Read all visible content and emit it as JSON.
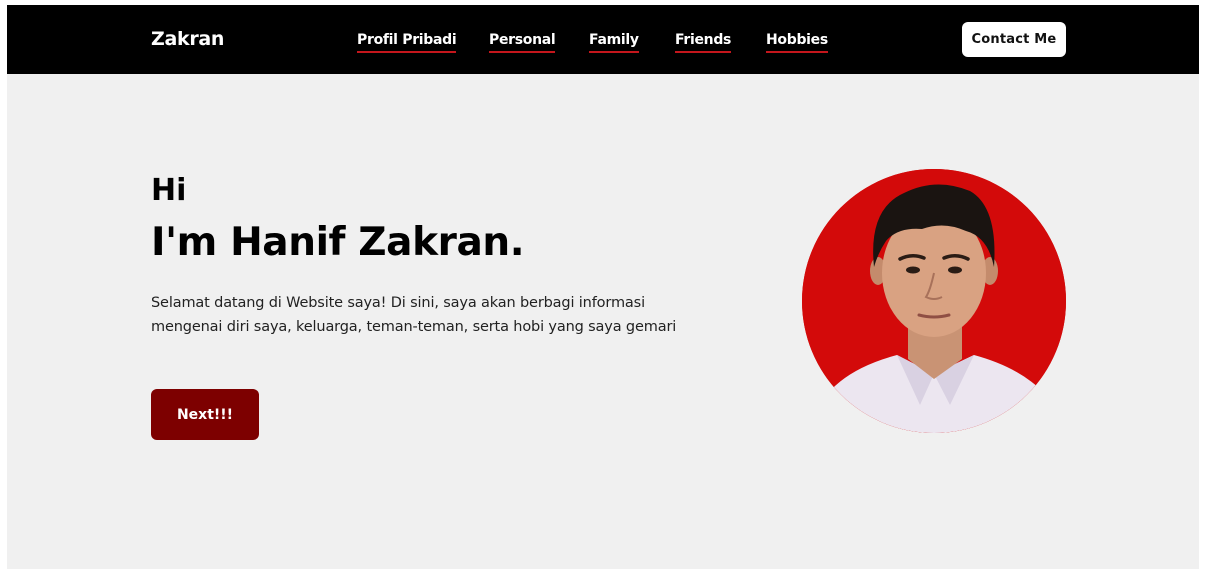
{
  "navbar": {
    "brand": "Zakran",
    "links": [
      {
        "label": "Profil Pribadi"
      },
      {
        "label": "Personal"
      },
      {
        "label": "Family"
      },
      {
        "label": "Friends"
      },
      {
        "label": "Hobbies"
      }
    ],
    "contact_label": "Contact Me"
  },
  "hero": {
    "greeting": "Hi",
    "name": "I'm Hanif Zakran.",
    "description": "Selamat datang di Website saya! Di sini, saya akan berbagi informasi mengenai diri saya, keluarga, teman-teman, serta hobi yang saya gemari",
    "next_label": "Next!!!"
  },
  "colors": {
    "navbar_bg": "#000000",
    "link_underline": "#c4161c",
    "page_bg": "#f0f0f0",
    "next_button": "#7d0000",
    "photo_bg": "#d30a0a"
  }
}
